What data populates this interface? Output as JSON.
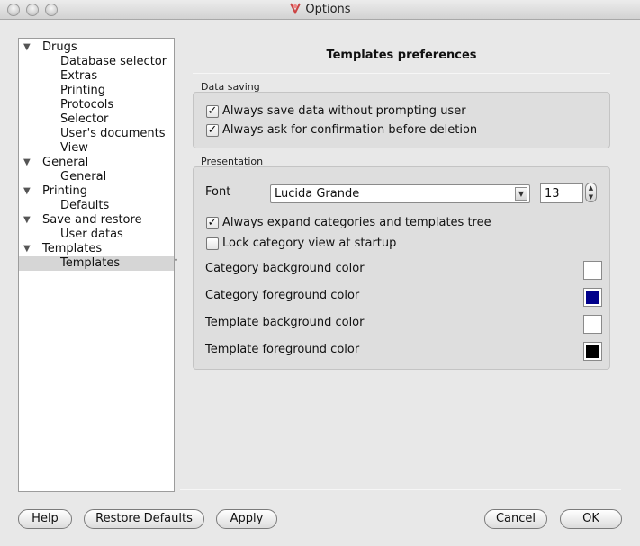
{
  "window": {
    "title": "Options",
    "app_icon": "app-logo-icon"
  },
  "tree": {
    "items": [
      {
        "label": "Drugs",
        "level": 0,
        "expanded": true
      },
      {
        "label": "Database selector",
        "level": 1
      },
      {
        "label": "Extras",
        "level": 1
      },
      {
        "label": "Printing",
        "level": 1
      },
      {
        "label": "Protocols",
        "level": 1
      },
      {
        "label": "Selector",
        "level": 1
      },
      {
        "label": "User's documents",
        "level": 1
      },
      {
        "label": "View",
        "level": 1
      },
      {
        "label": "General",
        "level": 0,
        "expanded": true
      },
      {
        "label": "General",
        "level": 1
      },
      {
        "label": "Printing",
        "level": 0,
        "expanded": true
      },
      {
        "label": "Defaults",
        "level": 1
      },
      {
        "label": "Save and restore",
        "level": 0,
        "expanded": true
      },
      {
        "label": "User datas",
        "level": 1
      },
      {
        "label": "Templates",
        "level": 0,
        "expanded": true
      },
      {
        "label": "Templates",
        "level": 1,
        "selected": true
      }
    ]
  },
  "preferences": {
    "title": "Templates preferences",
    "data_saving": {
      "label": "Data saving",
      "always_save": {
        "label": "Always save data without prompting user",
        "checked": true
      },
      "confirm_deletion": {
        "label": "Always ask for confirmation before deletion",
        "checked": true
      }
    },
    "presentation": {
      "label": "Presentation",
      "font_label": "Font",
      "font_value": "Lucida Grande",
      "font_size": "13",
      "expand_tree": {
        "label": "Always expand categories and templates tree",
        "checked": true
      },
      "lock_view": {
        "label": "Lock category view at startup",
        "checked": false
      },
      "colors": [
        {
          "label": "Category background color",
          "color": "#ffffff"
        },
        {
          "label": "Category foreground color",
          "color": "#00008b"
        },
        {
          "label": "Template background color",
          "color": "#ffffff"
        },
        {
          "label": "Template foreground color",
          "color": "#000000"
        }
      ]
    }
  },
  "buttons": {
    "help": "Help",
    "restore_defaults": "Restore Defaults",
    "apply": "Apply",
    "cancel": "Cancel",
    "ok": "OK"
  }
}
